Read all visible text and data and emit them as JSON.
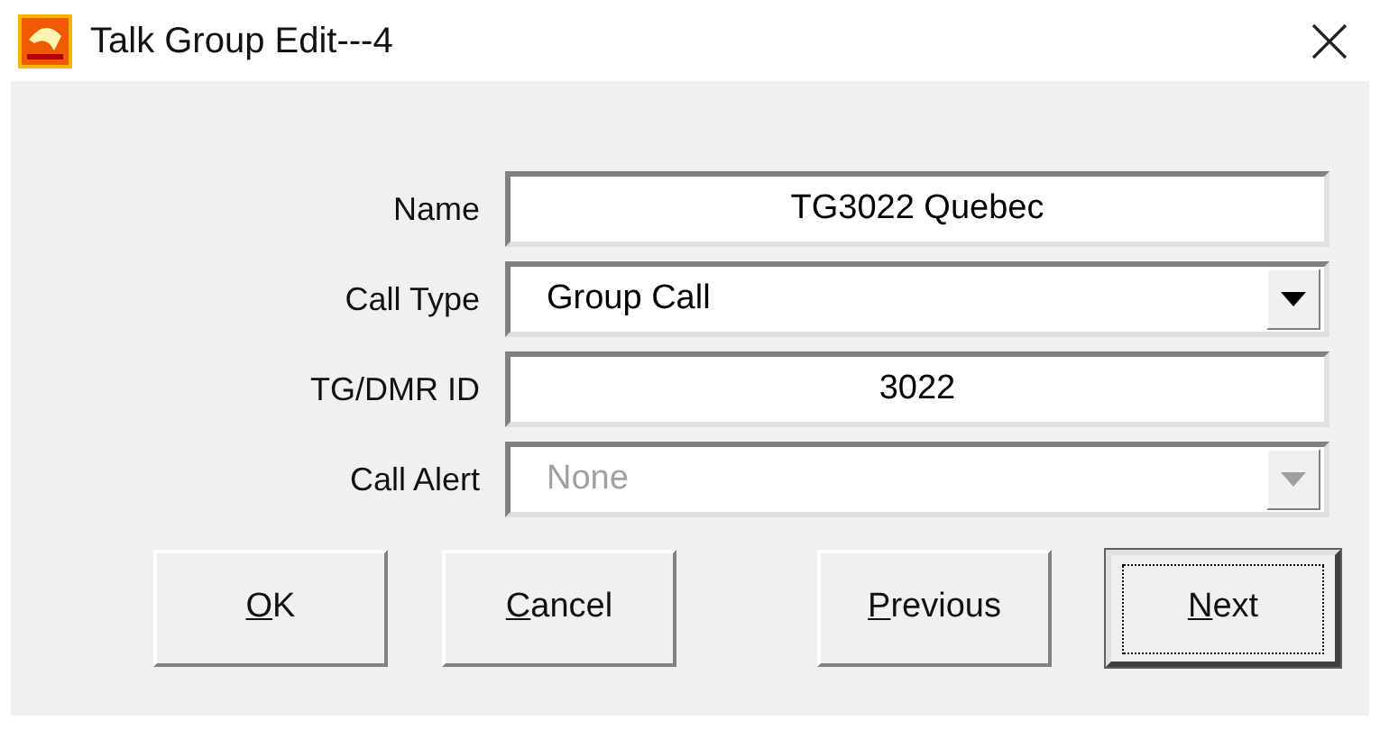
{
  "window": {
    "title": "Talk Group Edit---4"
  },
  "fields": [
    {
      "label": "Name",
      "kind": "text",
      "value": "TG3022 Quebec",
      "disabled": false
    },
    {
      "label": "Call Type",
      "kind": "dropdown",
      "value": "Group Call",
      "disabled": false
    },
    {
      "label": "TG/DMR ID",
      "kind": "text",
      "value": "3022",
      "disabled": false
    },
    {
      "label": "Call Alert",
      "kind": "dropdown",
      "value": "None",
      "disabled": true
    }
  ],
  "buttons": [
    {
      "mnemonic": "O",
      "rest": "K",
      "default": false
    },
    {
      "mnemonic": "C",
      "rest": "ancel",
      "default": false
    },
    {
      "mnemonic": "P",
      "rest": "revious",
      "default": false
    },
    {
      "mnemonic": "N",
      "rest": "ext",
      "default": true
    }
  ]
}
